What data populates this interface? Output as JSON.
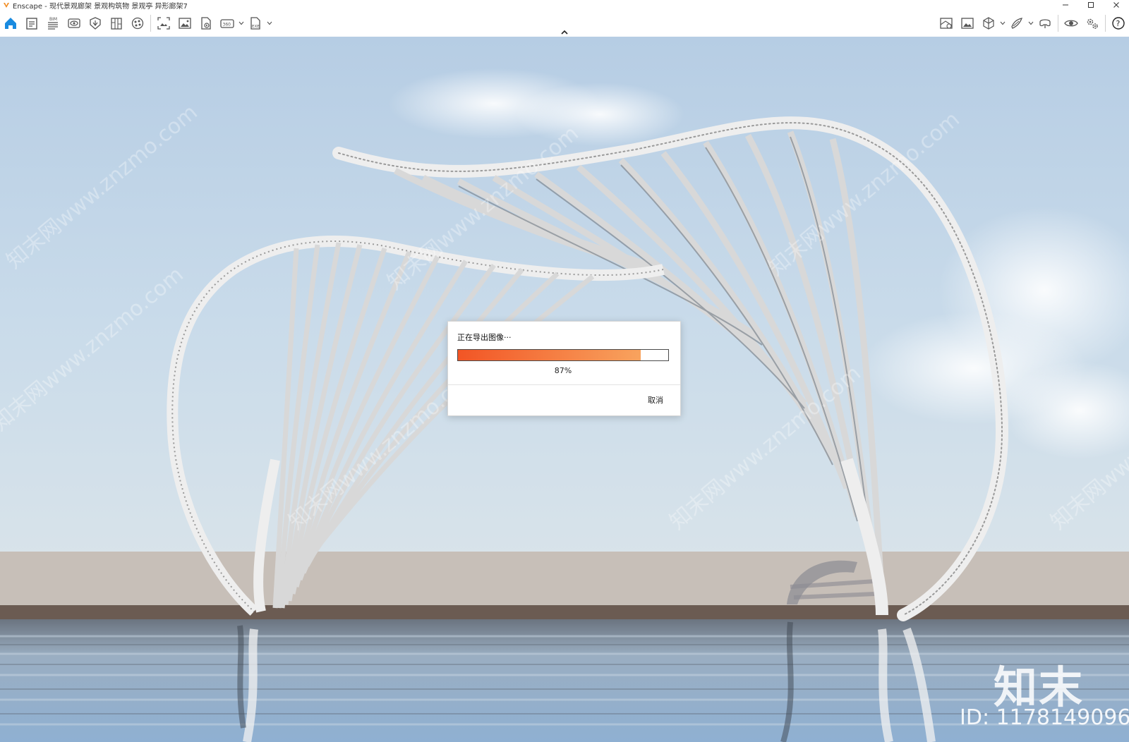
{
  "window": {
    "title": "Enscape - 现代景观廊架 景观构筑物 景观亭 异形廊架7",
    "controls": [
      "minimize-icon",
      "maximize-icon",
      "close-icon"
    ]
  },
  "toolbar": {
    "left_icons": [
      "home-icon",
      "notes-icon",
      "bim-icon",
      "view-icon",
      "asset-icon",
      "library-icon",
      "materials-icon",
      "screenshot-icon",
      "image-icon",
      "video-icon",
      "panorama-360-icon",
      "export-exe-icon"
    ],
    "right_icons": [
      "map-icon",
      "render-image-icon",
      "cube-view-icon",
      "sketch-icon",
      "vr-headset-icon",
      "visual-settings-icon",
      "settings-icon",
      "help-icon"
    ],
    "bim_badge": "BIM",
    "pano_badge": "360",
    "exe_badge": "EXE",
    "help_label": "?"
  },
  "dialog": {
    "title": "正在导出图像···",
    "progress": 0.87,
    "progress_label": "87%",
    "cancel_label": "取消",
    "colors": {
      "start": "#f25525",
      "end": "#f8a35e"
    }
  },
  "watermark": {
    "logo_text": "知末",
    "id_text": "ID: 1178149096",
    "diagonal_text": "知末网www.znzmo.com"
  }
}
